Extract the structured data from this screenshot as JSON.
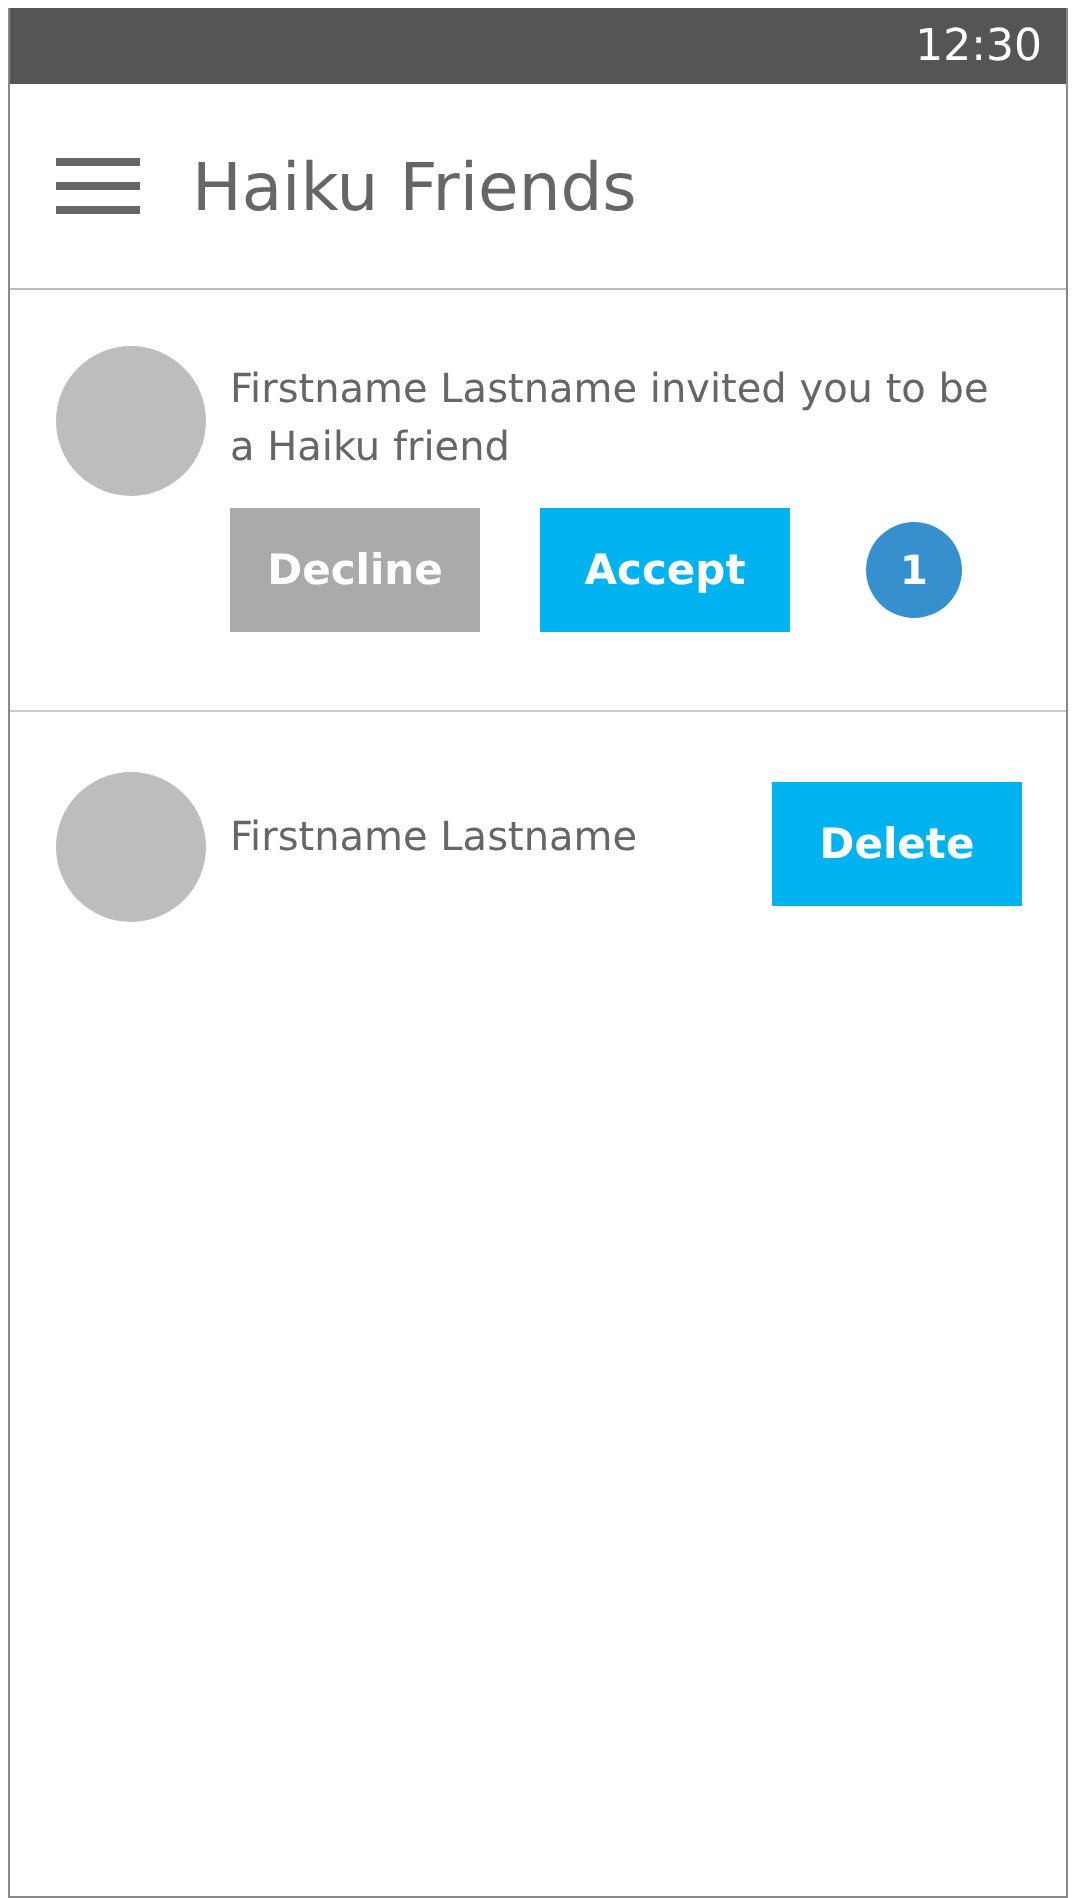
{
  "status_bar": {
    "time": "12:30"
  },
  "header": {
    "title": "Haiku Friends"
  },
  "invitations": [
    {
      "message": "Firstname Lastname invited you to be a Haiku friend",
      "actions": [
        {
          "label": "Decline",
          "kind": "decline"
        },
        {
          "label": "Accept",
          "kind": "accept"
        }
      ],
      "badge": "1"
    }
  ],
  "friends": [
    {
      "name": "Firstname Lastname",
      "action": "Delete"
    }
  ]
}
